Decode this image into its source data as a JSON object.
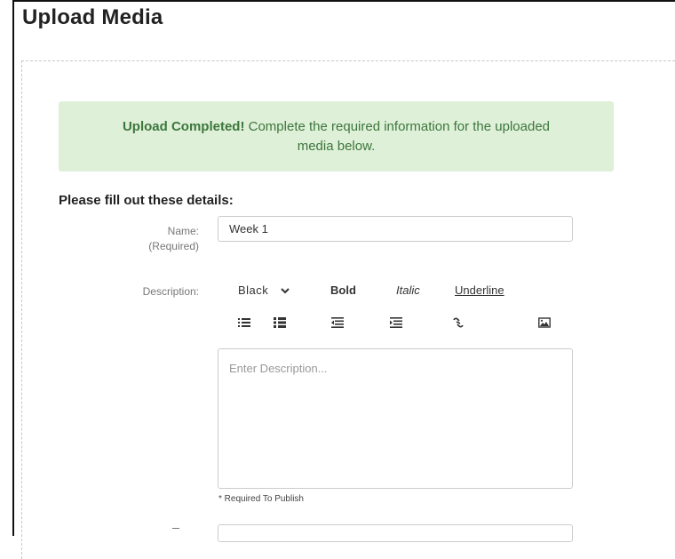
{
  "page": {
    "title": "Upload Media"
  },
  "alert": {
    "strong": "Upload Completed!",
    "message": " Complete the required information for the uploaded media below."
  },
  "form": {
    "heading": "Please fill out these details:",
    "name_label": "Name:",
    "name_required": "(Required)",
    "name_value": "Week 1",
    "description_label": "Description:",
    "color_select": "Black",
    "bold_label": "Bold",
    "italic_label": "Italic",
    "underline_label": "Underline",
    "description_placeholder": "Enter Description...",
    "required_hint": "* Required To Publish"
  },
  "icons": [
    "ordered-list-icon",
    "unordered-list-icon",
    "outdent-icon",
    "indent-icon",
    "link-icon",
    "image-icon",
    "chevron-down-icon"
  ],
  "colors": {
    "alert_bg": "#dff0d8",
    "alert_text": "#3c763d"
  }
}
